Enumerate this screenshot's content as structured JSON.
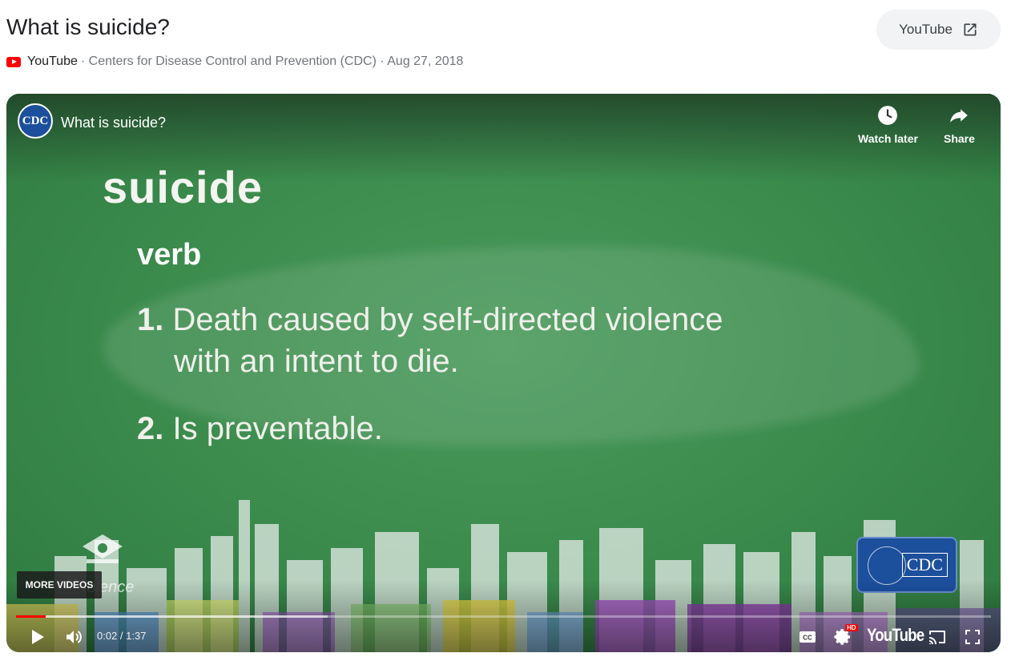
{
  "header": {
    "title": "What is suicide?",
    "source": "YouTube",
    "meta_rest": "· Centers for Disease Control and Prevention (CDC) · Aug 27, 2018",
    "open_button_label": "YouTube"
  },
  "player": {
    "channel_logo_text": "CDC",
    "video_title": "What is suicide?",
    "watch_later_label": "Watch later",
    "share_label": "Share",
    "slide": {
      "word": "suicide",
      "part_of_speech": "verb",
      "def1_num": "1.",
      "def1_line1": "Death caused by self-directed violence",
      "def1_line2": "with an intent to die.",
      "def2_num": "2.",
      "def2_text": "Is preventable."
    },
    "watermark_text": "iolence",
    "badge_text": "CDC",
    "more_videos_label": "MORE VIDEOS",
    "time_display": "0:02 / 1:37",
    "hd_badge": "HD",
    "youtube_wordmark": "YouTube",
    "progress_played": 0.03,
    "progress_loaded": 0.32
  },
  "colors": {
    "player_green": "#3c8a4e",
    "progress_red": "#ff0000",
    "cdc_blue": "#1c4f9c"
  }
}
